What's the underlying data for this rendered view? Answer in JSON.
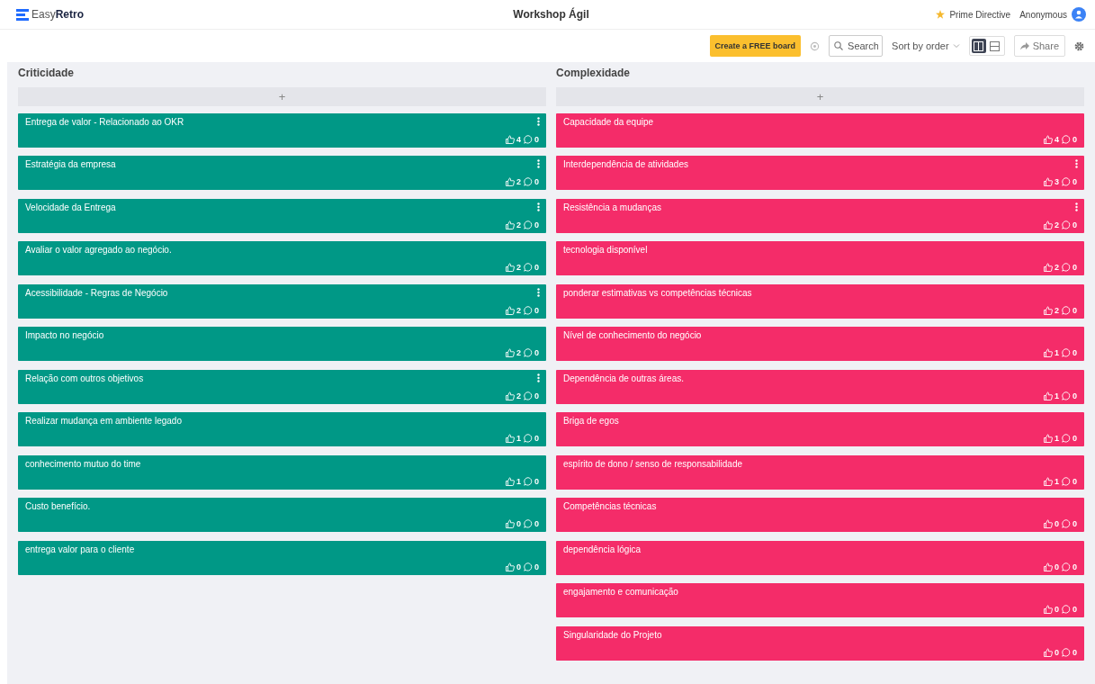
{
  "header": {
    "logo_light": "Easy",
    "logo_bold": "Retro",
    "title": "Workshop Ágil",
    "prime_directive": "Prime Directive",
    "user": "Anonymous"
  },
  "toolbar": {
    "create_button": "Create a FREE board",
    "search": {
      "placeholder": "Search"
    },
    "sort": "Sort by order",
    "views": [
      {
        "kind": "columns",
        "selected": true
      },
      {
        "kind": "rows",
        "selected": false
      }
    ],
    "share": "Share"
  },
  "columns": [
    {
      "title": "Criticidade",
      "color": "#009886",
      "add": "+",
      "cards": [
        {
          "text": "Entrega de valor - Relacionado ao OKR",
          "likes": "4",
          "comments": "0",
          "menu": true
        },
        {
          "text": "Estratégia da empresa",
          "likes": "2",
          "comments": "0",
          "menu": true
        },
        {
          "text": "Velocidade da Entrega",
          "likes": "2",
          "comments": "0",
          "menu": true
        },
        {
          "text": "Avaliar o valor agregado ao negócio.",
          "likes": "2",
          "comments": "0",
          "menu": false
        },
        {
          "text": "Acessibilidade - Regras de Negócio",
          "likes": "2",
          "comments": "0",
          "menu": true
        },
        {
          "text": "Impacto no negócio",
          "likes": "2",
          "comments": "0",
          "menu": false
        },
        {
          "text": "Relação com outros objetivos",
          "likes": "2",
          "comments": "0",
          "menu": true
        },
        {
          "text": "Realizar mudança em ambiente legado",
          "likes": "1",
          "comments": "0",
          "menu": false
        },
        {
          "text": "conhecimento mutuo do time",
          "likes": "1",
          "comments": "0",
          "menu": false
        },
        {
          "text": "Custo benefício.",
          "likes": "0",
          "comments": "0",
          "menu": false
        },
        {
          "text": "entrega valor para o cliente",
          "likes": "0",
          "comments": "0",
          "menu": false
        }
      ]
    },
    {
      "title": "Complexidade",
      "color": "#f42c69",
      "add": "+",
      "cards": [
        {
          "text": "Capacidade da equipe",
          "likes": "4",
          "comments": "0",
          "menu": false
        },
        {
          "text": "Interdependência de atividades",
          "likes": "3",
          "comments": "0",
          "menu": true
        },
        {
          "text": "Resistência a mudanças",
          "likes": "2",
          "comments": "0",
          "menu": true
        },
        {
          "text": "tecnologia disponível",
          "likes": "2",
          "comments": "0",
          "menu": false
        },
        {
          "text": "ponderar estimativas vs competências técnicas",
          "likes": "2",
          "comments": "0",
          "menu": false
        },
        {
          "text": "Nível de conhecimento do negócio",
          "likes": "1",
          "comments": "0",
          "menu": false
        },
        {
          "text": "Dependência de outras áreas.",
          "likes": "1",
          "comments": "0",
          "menu": false
        },
        {
          "text": "Briga de egos",
          "likes": "1",
          "comments": "0",
          "menu": false
        },
        {
          "text": "espírito de dono / senso de responsabilidade",
          "likes": "1",
          "comments": "0",
          "menu": false
        },
        {
          "text": "Competências técnicas",
          "likes": "0",
          "comments": "0",
          "menu": false
        },
        {
          "text": "dependência lógica",
          "likes": "0",
          "comments": "0",
          "menu": false
        },
        {
          "text": "engajamento e comunicação",
          "likes": "0",
          "comments": "0",
          "menu": false
        },
        {
          "text": "Singularidade do Projeto",
          "likes": "0",
          "comments": "0",
          "menu": false
        }
      ]
    }
  ]
}
